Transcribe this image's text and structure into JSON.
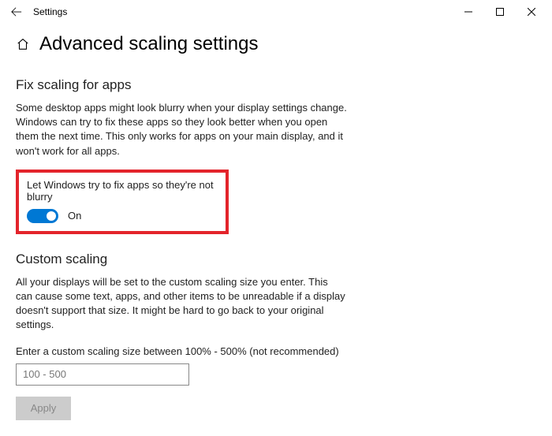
{
  "titlebar": {
    "app_title": "Settings"
  },
  "header": {
    "page_title": "Advanced scaling settings"
  },
  "fix_scaling": {
    "section_title": "Fix scaling for apps",
    "description": "Some desktop apps might look blurry when your display settings change. Windows can try to fix these apps so they look better when you open them the next time. This only works for apps on your main display, and it won't work for all apps.",
    "toggle_label": "Let Windows try to fix apps so they're not blurry",
    "toggle_state": "On"
  },
  "custom_scaling": {
    "section_title": "Custom scaling",
    "description": "All your displays will be set to the custom scaling size you enter. This can cause some text, apps, and other items to be unreadable if a display doesn't support that size. It might be hard to go back to your original settings.",
    "input_label": "Enter a custom scaling size between 100% - 500% (not recommended)",
    "input_placeholder": "100 - 500",
    "apply_label": "Apply"
  }
}
